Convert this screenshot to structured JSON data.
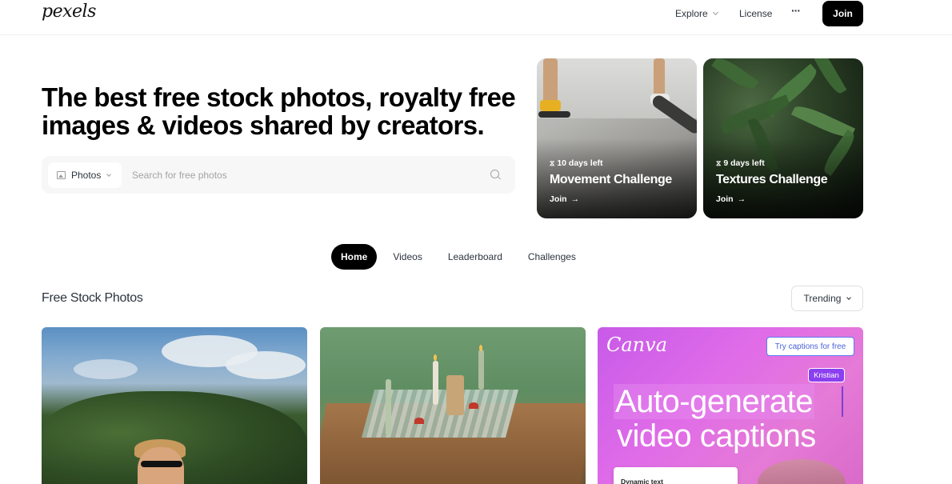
{
  "header": {
    "logo": "pexels",
    "nav": {
      "explore": "Explore",
      "license": "License",
      "more": "···",
      "join": "Join"
    }
  },
  "hero": {
    "title_line1": "The best free stock photos, royalty free",
    "title_line2": "images & videos shared by creators.",
    "search": {
      "type": "Photos",
      "placeholder": "Search for free photos"
    }
  },
  "challenges": [
    {
      "days_left": "10 days left",
      "title": "Movement Challenge",
      "join": "Join"
    },
    {
      "days_left": "9 days left",
      "title": "Textures Challenge",
      "join": "Join"
    }
  ],
  "tabs": [
    {
      "label": "Home",
      "active": true
    },
    {
      "label": "Videos",
      "active": false
    },
    {
      "label": "Leaderboard",
      "active": false
    },
    {
      "label": "Challenges",
      "active": false
    }
  ],
  "section": {
    "title": "Free Stock Photos",
    "sort": "Trending"
  },
  "ad": {
    "brand": "Canva",
    "try_button": "Try captions for free",
    "tag": "Kristian",
    "headline_line1": "Auto-generate",
    "headline_line2": "video captions",
    "card_text": "Dynamic text"
  },
  "icons": {
    "arrow": "→",
    "hourglass": "⧖"
  }
}
